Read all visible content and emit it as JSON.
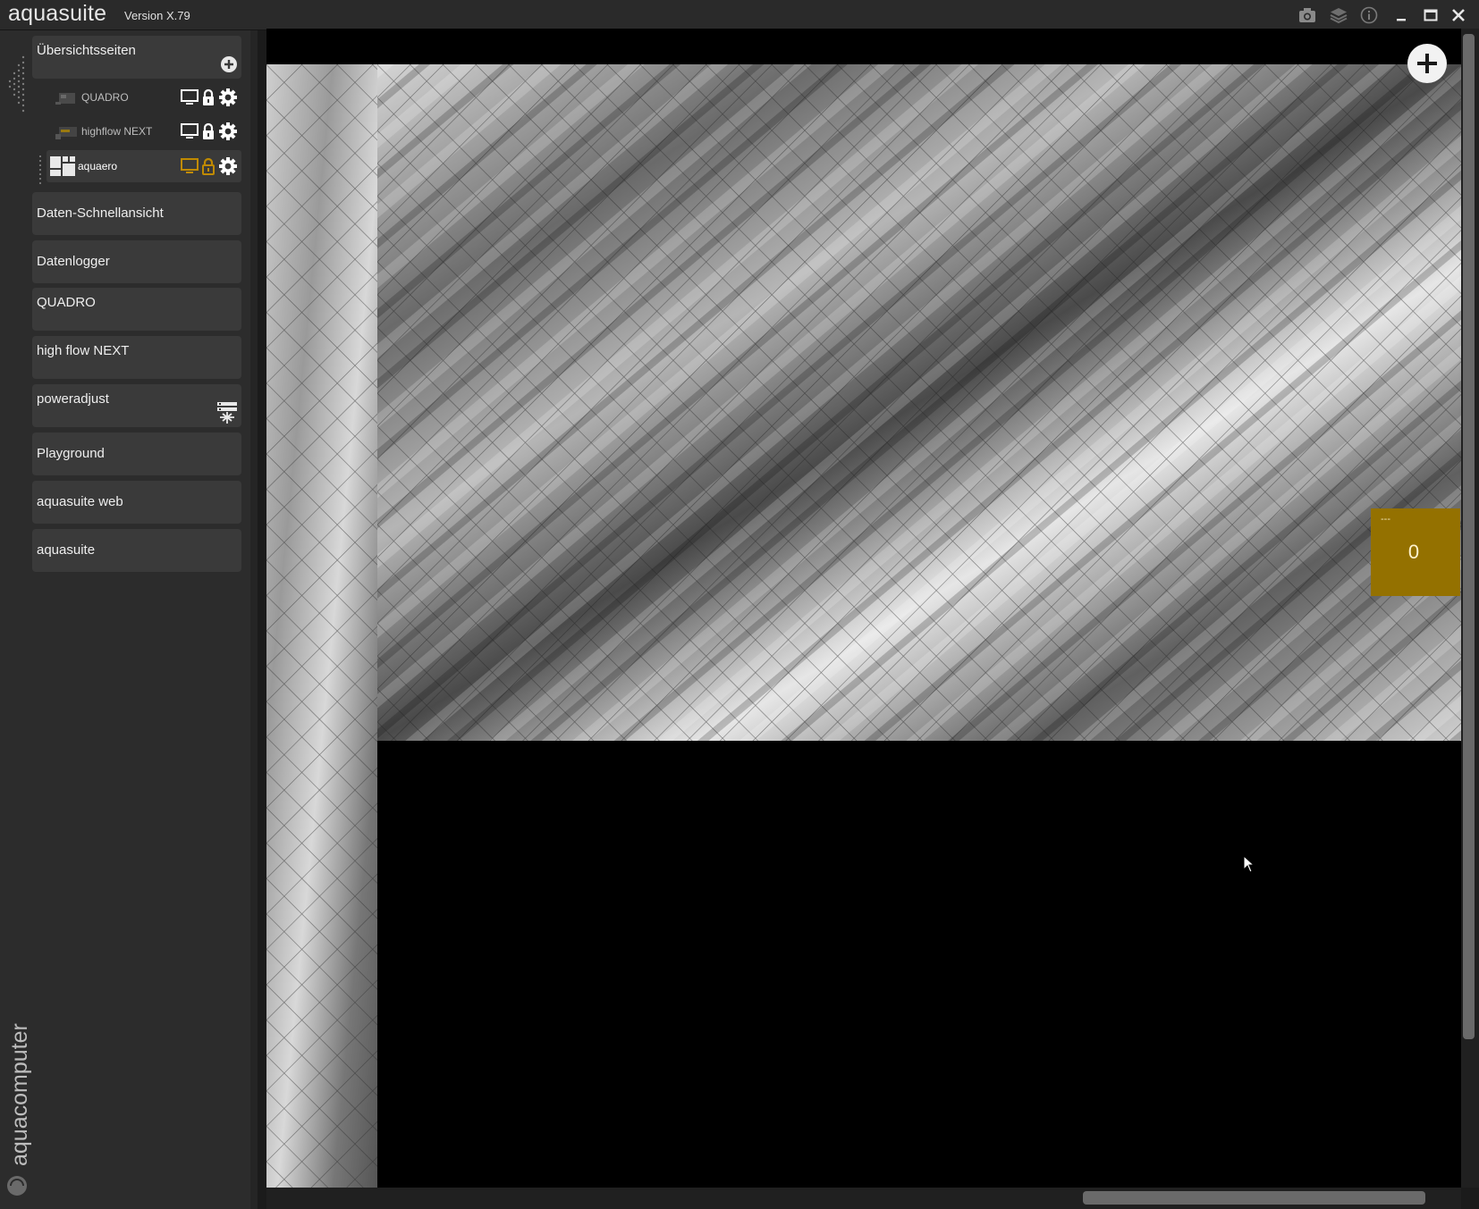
{
  "window": {
    "app_name": "aquasuite",
    "version": "Version X.79",
    "controls": [
      "camera-icon",
      "layers-icon",
      "info-icon",
      "minimize-icon",
      "maximize-icon",
      "close-icon"
    ]
  },
  "sidebar": {
    "section_title": "Übersichtsseiten",
    "subitems": [
      {
        "label": "QUADRO",
        "icon_color": "#ffffff"
      },
      {
        "label": "highflow NEXT",
        "icon_color": "#ffffff"
      },
      {
        "label": "aquaero",
        "icon_color": "#c08a00"
      }
    ],
    "items": [
      {
        "label": "Daten-Schnellansicht"
      },
      {
        "label": "Datenlogger"
      },
      {
        "label": "QUADRO"
      },
      {
        "label": "high flow NEXT"
      },
      {
        "label": "poweradjust"
      },
      {
        "label": "Playground"
      },
      {
        "label": "aquasuite web"
      },
      {
        "label": "aquasuite"
      }
    ],
    "brand_text": "aquacomputer"
  },
  "canvas": {
    "tile": {
      "label": "---",
      "value": "0",
      "color": "#947100"
    }
  }
}
